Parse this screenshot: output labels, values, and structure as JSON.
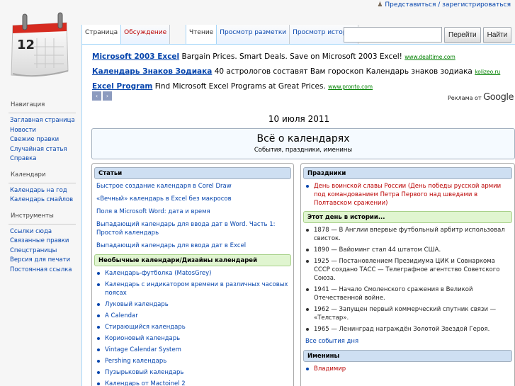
{
  "header": {
    "personal_links": "Представиться / зарегистрироваться",
    "logo_day": "12"
  },
  "tabs": {
    "left": [
      {
        "label": "Страница",
        "selected": true
      },
      {
        "label": "Обсуждение",
        "red": true
      }
    ],
    "right": [
      {
        "label": "Чтение",
        "selected": true
      },
      {
        "label": "Просмотр разметки"
      },
      {
        "label": "Просмотр истории"
      }
    ]
  },
  "search": {
    "value": "",
    "go_label": "Перейти",
    "find_label": "Найти"
  },
  "sidebar": {
    "sections": [
      {
        "title": "Навигация",
        "items": [
          "Заглавная страница",
          "Новости",
          "Свежие правки",
          "Случайная статья",
          "Справка"
        ]
      },
      {
        "title": "Календари",
        "items": [
          "Календарь на год",
          "Календарь смайлов"
        ]
      },
      {
        "title": "Инструменты",
        "items": [
          "Ссылки сюда",
          "Связанные правки",
          "Спецстраницы",
          "Версия для печати",
          "Постоянная ссылка"
        ]
      }
    ]
  },
  "ads": {
    "items": [
      {
        "title": "Microsoft 2003 Excel",
        "text": "Bargain Prices. Smart Deals. Save on Microsoft 2003 Excel!",
        "url": "www.dealtime.com"
      },
      {
        "title": "Календарь Знаков Зодиака",
        "text": "40 астрологов составят Вам гороскоп Календарь знаков зодиака",
        "url": "kolizeo.ru"
      },
      {
        "title": "Excel Program",
        "text": "Find Microsoft Excel Programs at Great Prices.",
        "url": "www.pronto.com"
      }
    ],
    "prev_icon": "‹",
    "next_icon": "›",
    "ads_by_label": "Реклама от",
    "ads_by_brand": "Google"
  },
  "main": {
    "date": "10 июля 2011",
    "banner_title": "Всё о календарях",
    "banner_subtitle": "События, праздники, именины"
  },
  "left_column": {
    "articles_title": "Статьи",
    "articles": [
      "Быстрое создание календаря в Corel Draw",
      "«Вечный» календарь в Excel без макросов",
      "Поля в Microsoft Word: дата и время",
      "Выпадающий календарь для ввода дат в Word. Часть 1: Простой календарь",
      "Выпадающий календарь для ввода дат в Excel"
    ],
    "unusual_title": "Необычные календари/Дизайны календарей",
    "unusual": [
      "Календарь-футболка (MatosGrey)",
      "Календарь с индикатором времени в различных часовых поясах",
      "Луковый календарь",
      "A Calendar",
      "Стирающийся календарь",
      "Корионовый календарь",
      "Vintage Calendar System",
      "Pershing календарь",
      "Пузырьковый календарь",
      "Календарь от Mactoinel 2"
    ]
  },
  "right_column": {
    "holidays_title": "Праздники",
    "holidays": [
      "День воинской славы России (День победы русской армии под командованием Петра Первого над шведами в Полтавском сражении)"
    ],
    "today_title": "Этот день в истории...",
    "events": [
      "1878 — В Англии впервые футбольный арбитр использовал свисток.",
      "1890 — Вайоминг стал 44 штатом США.",
      "1925 — Постановлением Президиума ЦИК и Совнаркома СССР создано ТАСС — Телеграфное агентство Советского Союза.",
      "1941 — Начало Смоленского сражения в Великой Отечественной войне.",
      "1962 — Запущен первый коммерческий спутник связи — «Телстар».",
      "1965 — Ленинград награждён Золотой Звездой Героя."
    ],
    "all_events_link": "Все события дня",
    "namedays_title": "Именины",
    "namedays": [
      "Владимир"
    ]
  }
}
